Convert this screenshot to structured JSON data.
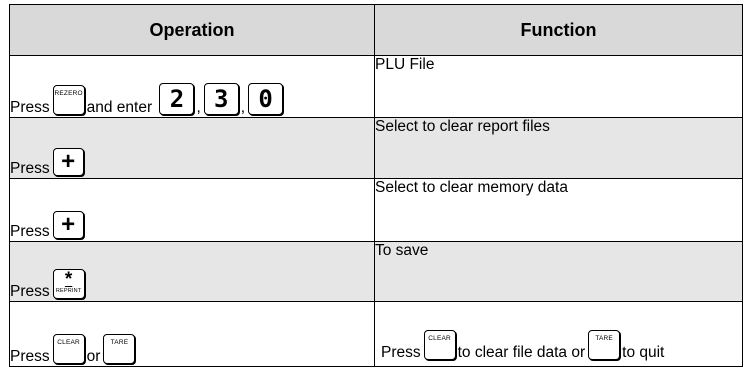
{
  "table": {
    "headers": [
      "Operation",
      "Function"
    ],
    "rows": [
      {
        "op": {
          "press": "Press",
          "key1": "REZERO",
          "and_enter": "and enter",
          "digit1": "2",
          "digit2": "3",
          "digit3": "0",
          "comma": ","
        },
        "fn": "PLU File"
      },
      {
        "op": {
          "press": "Press",
          "key": "+"
        },
        "fn": "Select to clear report files"
      },
      {
        "op": {
          "press": "Press",
          "key": "+"
        },
        "fn": "Select to clear memory data"
      },
      {
        "op": {
          "press": "Press",
          "key_symbol": "*",
          "key_label": "REPRINT"
        },
        "fn": "To save"
      },
      {
        "op": {
          "press": "Press",
          "key1": "CLEAR",
          "or": "or",
          "key2": "TARE"
        },
        "fn": {
          "press": "Press",
          "key1": "CLEAR",
          "text1": "to clear file data or",
          "key2": "TARE",
          "text2": "to quit"
        }
      }
    ]
  },
  "colors": {
    "header_bg": "#d9d9d9",
    "shaded_row_bg": "#e6e6e6",
    "border": "#000000"
  }
}
